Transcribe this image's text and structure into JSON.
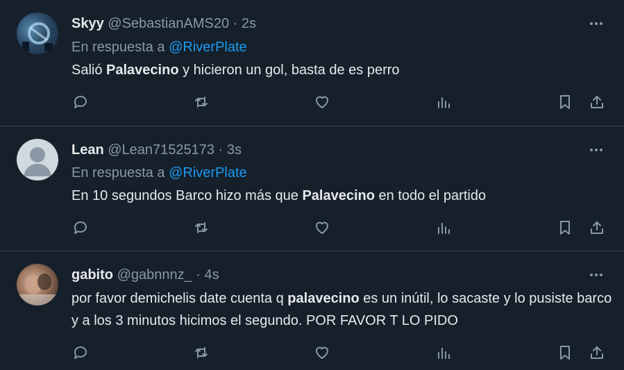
{
  "tweets": [
    {
      "name": "Skyy",
      "handle": "@SebastianAMS20",
      "sep": "·",
      "time": "2s",
      "reply_prefix": "En respuesta a",
      "reply_mention": "@RiverPlate",
      "text_parts": [
        "Salió ",
        "Palavecino",
        " y hicieron un gol, basta de es perro"
      ]
    },
    {
      "name": "Lean",
      "handle": "@Lean71525173",
      "sep": "·",
      "time": "3s",
      "reply_prefix": "En respuesta a",
      "reply_mention": "@RiverPlate",
      "text_parts": [
        "En 10 segundos Barco hizo más que ",
        "Palavecino",
        " en todo el partido"
      ]
    },
    {
      "name": "gabito",
      "handle": "@gabnnnz_",
      "sep": "·",
      "time": "4s",
      "text_parts": [
        "por favor demichelis date cuenta q ",
        "palavecino",
        " es un inútil, lo sacaste y lo pusiste barco y a los 3 minutos hicimos el segundo. POR FAVOR T LO PIDO"
      ]
    }
  ],
  "icons": {
    "more": "more-options-icon",
    "reply": "reply-icon",
    "retweet": "retweet-icon",
    "like": "like-icon",
    "views": "views-icon",
    "bookmark": "bookmark-icon",
    "share": "share-icon"
  },
  "colors": {
    "background": "#15202b",
    "text": "#e7e9ea",
    "muted": "#8b98a5",
    "mention": "#1d9bf0",
    "divider": "#38444d"
  }
}
